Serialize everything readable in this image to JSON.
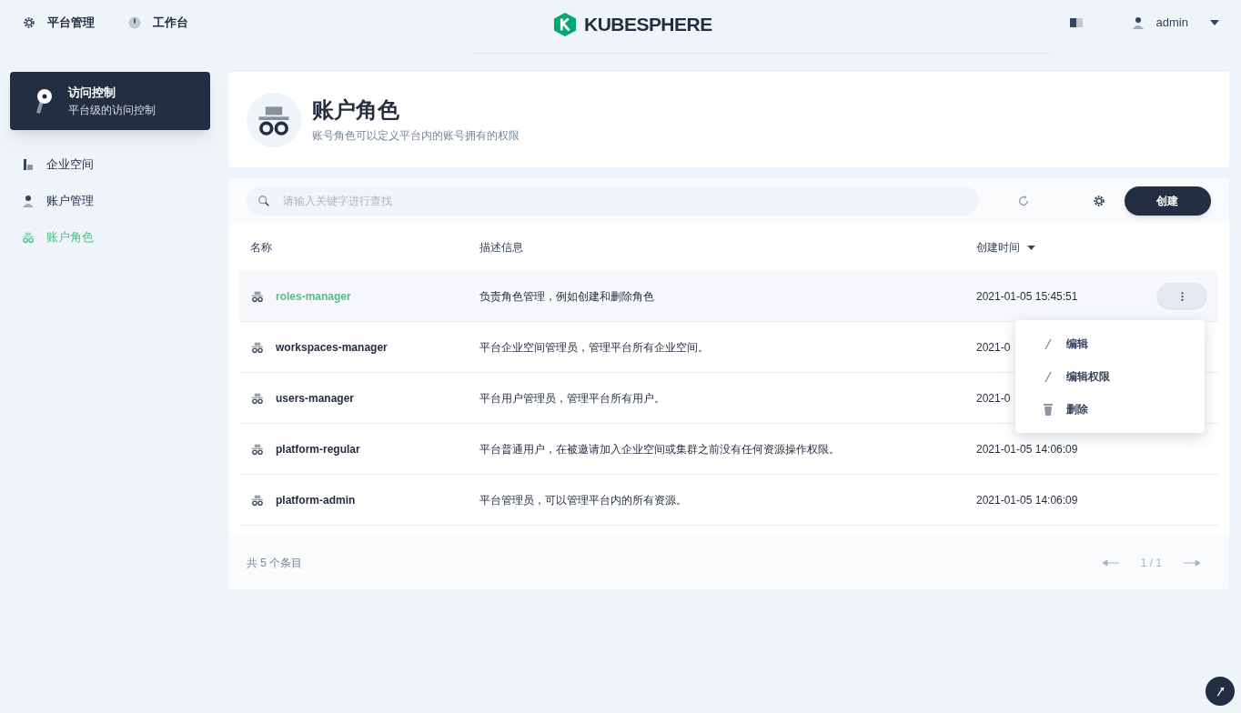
{
  "header": {
    "nav": [
      {
        "label": "平台管理",
        "kind": "gear"
      },
      {
        "label": "工作台",
        "kind": "dashboard"
      }
    ],
    "logo": "KUBESPHERE",
    "user": "admin"
  },
  "sidebar": {
    "card": {
      "title": "访问控制",
      "subtitle": "平台级的访问控制"
    },
    "items": [
      {
        "label": "企业空间",
        "kind": "building",
        "selected": false
      },
      {
        "label": "账户管理",
        "kind": "user",
        "selected": false
      },
      {
        "label": "账户角色",
        "kind": "role",
        "selected": true
      }
    ]
  },
  "banner": {
    "title": "账户角色",
    "description": "账号角色可以定义平台内的账号拥有的权限"
  },
  "toolbar": {
    "search_placeholder": "请输入关键字进行查找",
    "create": "创建"
  },
  "table": {
    "columns": [
      "名称",
      "描述信息",
      "创建时间"
    ],
    "rows": [
      {
        "name": "roles-manager",
        "description": "负责角色管理，例如创建和删除角色",
        "created": "2021-01-05 15:45:51",
        "selected": true
      },
      {
        "name": "workspaces-manager",
        "description": "平台企业空间管理员，管理平台所有企业空间。",
        "created": "2021-0",
        "selected": false
      },
      {
        "name": "users-manager",
        "description": "平台用户管理员，管理平台所有用户。",
        "created": "2021-0",
        "selected": false
      },
      {
        "name": "platform-regular",
        "description": "平台普通用户，在被邀请加入企业空间或集群之前没有任何资源操作权限。",
        "created": "2021-01-05 14:06:09",
        "selected": false
      },
      {
        "name": "platform-admin",
        "description": "平台管理员，可以管理平台内的所有资源。",
        "created": "2021-01-05 14:06:09",
        "selected": false
      }
    ]
  },
  "menu": [
    {
      "label": "编辑",
      "kind": "pencil"
    },
    {
      "label": "编辑权限",
      "kind": "pencil"
    },
    {
      "label": "删除",
      "kind": "trash"
    }
  ],
  "footer": {
    "total": "共 5 个条目",
    "page": "1 / 1"
  }
}
